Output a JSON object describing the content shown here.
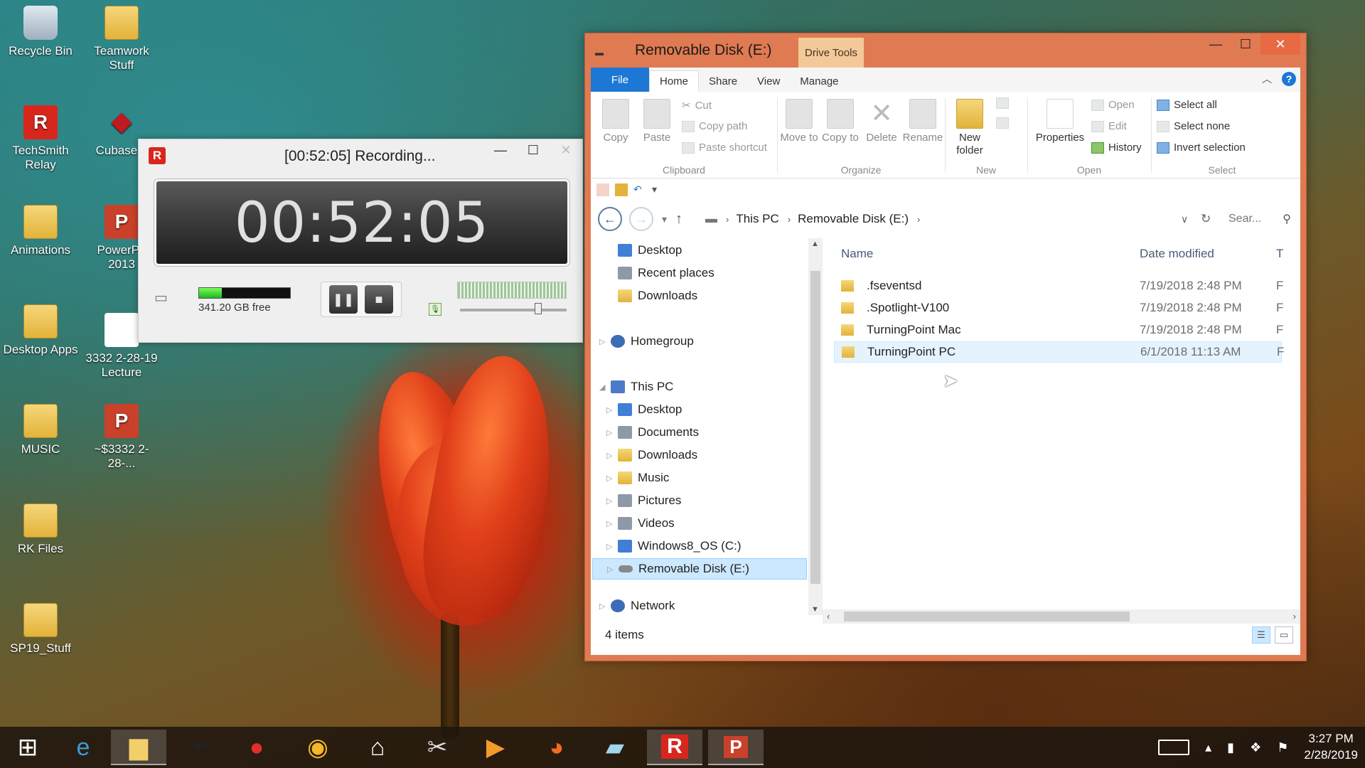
{
  "desktop": {
    "icons": [
      {
        "label": "Recycle Bin"
      },
      {
        "label": "Teamwork Stuff"
      },
      {
        "label": "TechSmith Relay"
      },
      {
        "label": "Cubase L"
      },
      {
        "label": "Animations"
      },
      {
        "label": "PowerPo 2013"
      },
      {
        "label": "Desktop Apps"
      },
      {
        "label": "3332 2-28-19 Lecture"
      },
      {
        "label": "MUSIC"
      },
      {
        "label": "~$3332 2-28-..."
      },
      {
        "label": "RK Files"
      },
      {
        "label": "SP19_Stuff"
      }
    ]
  },
  "recorder": {
    "title": "[00:52:05] Recording...",
    "time": "00:52:05",
    "disk_free": "341.20 GB free",
    "disk_used_fraction": 0.25,
    "volume_level": 0.75,
    "logo": "R"
  },
  "explorer": {
    "title": "Removable Disk (E:)",
    "context_tab": "Drive Tools",
    "tabs": [
      "File",
      "Home",
      "Share",
      "View",
      "Manage"
    ],
    "ribbon": {
      "clipboard": {
        "copy": "Copy",
        "paste": "Paste",
        "cut": "Cut",
        "copy_path": "Copy path",
        "paste_shortcut": "Paste shortcut",
        "label": "Clipboard"
      },
      "organize": {
        "move_to": "Move to",
        "copy_to": "Copy to",
        "delete": "Delete",
        "rename": "Rename",
        "label": "Organize"
      },
      "new": {
        "new_folder": "New folder",
        "label": "New"
      },
      "open": {
        "properties": "Properties",
        "open": "Open",
        "edit": "Edit",
        "history": "History",
        "label": "Open"
      },
      "select": {
        "select_all": "Select all",
        "select_none": "Select none",
        "invert": "Invert selection",
        "label": "Select"
      }
    },
    "address": {
      "crumbs": [
        "This PC",
        "Removable Disk (E:)"
      ],
      "search_placeholder": "Sear..."
    },
    "nav": {
      "quick": [
        "Desktop",
        "Recent places",
        "Downloads"
      ],
      "homegroup": "Homegroup",
      "this_pc": "This PC",
      "this_pc_items": [
        "Desktop",
        "Documents",
        "Downloads",
        "Music",
        "Pictures",
        "Videos",
        "Windows8_OS (C:)",
        "Removable Disk (E:)"
      ],
      "network": "Network"
    },
    "columns": {
      "name": "Name",
      "date": "Date modified",
      "type": "T"
    },
    "files": [
      {
        "name": ".fseventsd",
        "date": "7/19/2018 2:48 PM",
        "type": "F"
      },
      {
        "name": ".Spotlight-V100",
        "date": "7/19/2018 2:48 PM",
        "type": "F"
      },
      {
        "name": "TurningPoint Mac",
        "date": "7/19/2018 2:48 PM",
        "type": "F"
      },
      {
        "name": "TurningPoint PC",
        "date": "6/1/2018 11:13 AM",
        "type": "F"
      }
    ],
    "status": "4 items"
  },
  "taskbar": {
    "time": "3:27 PM",
    "date": "2/28/2019"
  }
}
